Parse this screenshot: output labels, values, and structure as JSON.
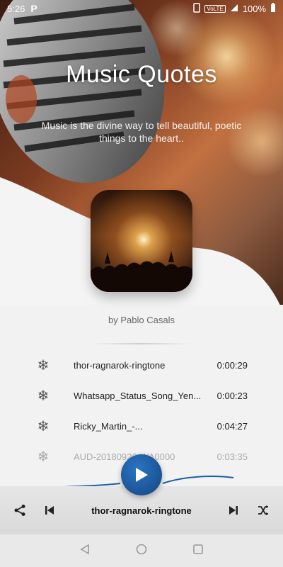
{
  "status": {
    "time": "5:26",
    "app_icon": "P",
    "network": "VoLTE",
    "battery": "100%"
  },
  "hero": {
    "title": "Music Quotes",
    "quote": "Music is the divine way to tell beautiful, poetic things to the heart.."
  },
  "author": "by Pablo Casals",
  "tracks": [
    {
      "name": "thor-ragnarok-ringtone",
      "duration": "0:00:29"
    },
    {
      "name": "Whatsapp_Status_Song_Yen...",
      "duration": "0:00:23"
    },
    {
      "name": "Ricky_Martin_-...",
      "duration": "0:04:27"
    },
    {
      "name": "AUD-20180926-WA0000",
      "duration": "0:03:35"
    }
  ],
  "player": {
    "now_playing": "thor-ragnarok-ringtone",
    "accent": "#1e5ea8"
  }
}
